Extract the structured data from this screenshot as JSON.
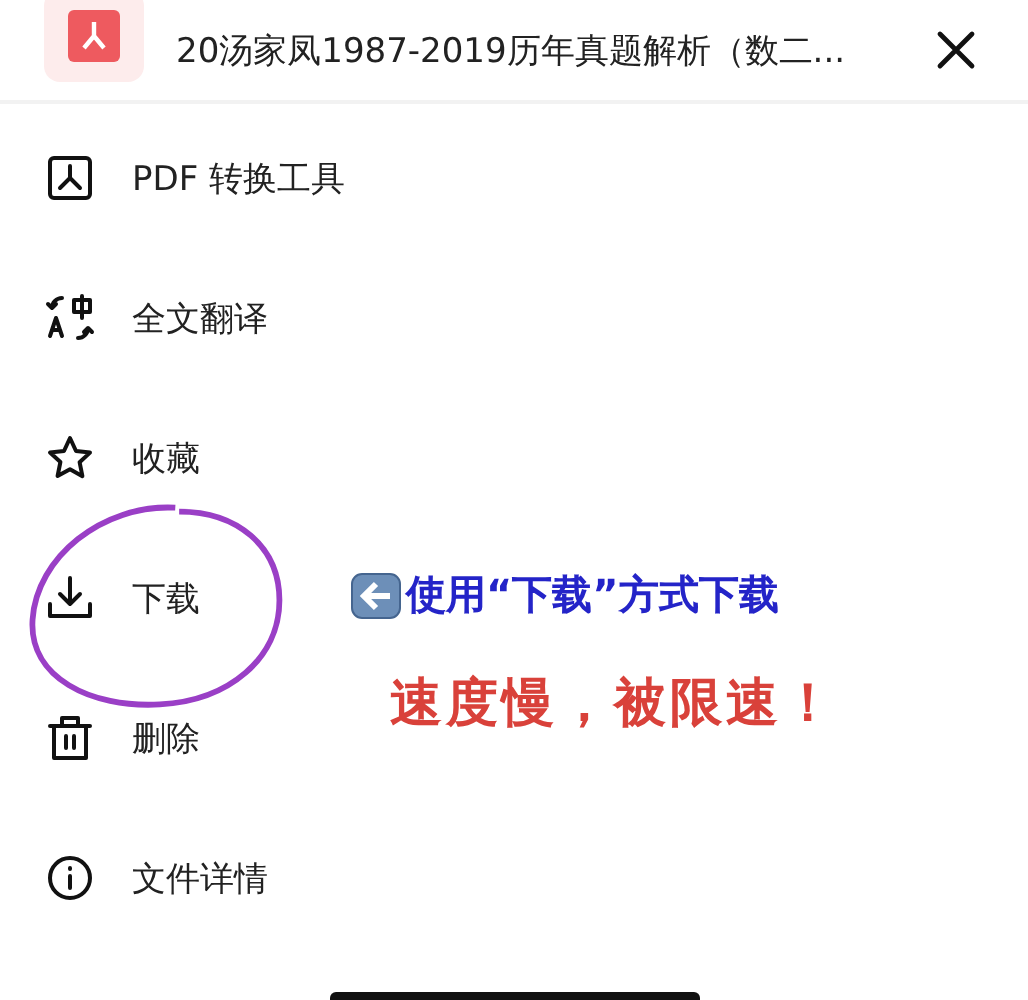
{
  "header": {
    "title": "20汤家凤1987-2019历年真题解析（数二..."
  },
  "menu": [
    {
      "kind": "pdf",
      "label": "PDF 转换工具"
    },
    {
      "kind": "translate",
      "label": "全文翻译"
    },
    {
      "kind": "star",
      "label": "收藏"
    },
    {
      "kind": "download",
      "label": "下载"
    },
    {
      "kind": "trash",
      "label": "删除"
    },
    {
      "kind": "info",
      "label": "文件详情"
    }
  ],
  "annotation": {
    "note": "使用“下载”方式下载",
    "warning": "速度慢，被限速！"
  }
}
